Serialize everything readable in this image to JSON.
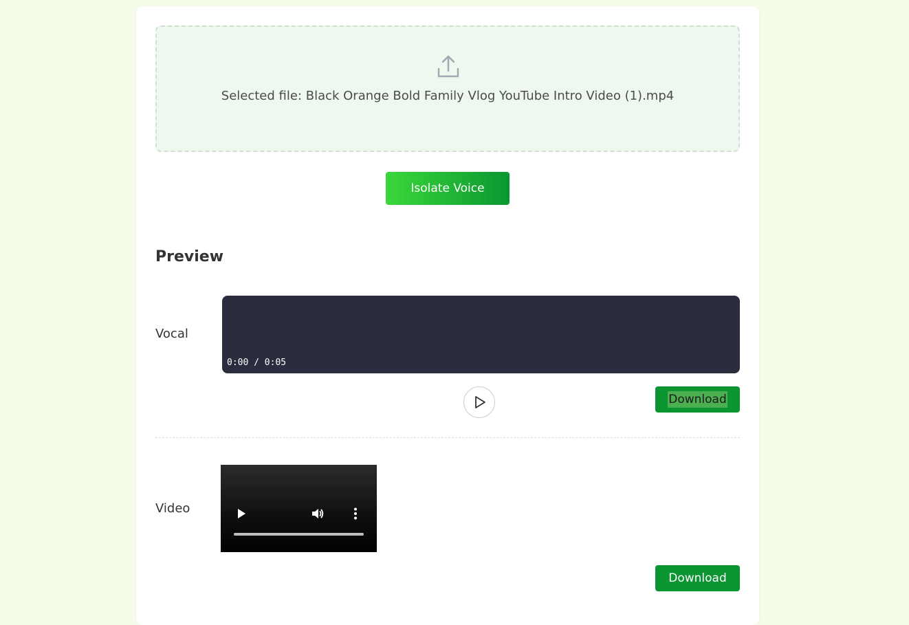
{
  "upload": {
    "icon": "upload-icon",
    "selected_file_text": "Selected file: Black Orange Bold Family Vlog YouTube Intro Video (1).mp4"
  },
  "actions": {
    "isolate_label": "Isolate Voice"
  },
  "preview": {
    "title": "Preview",
    "vocal": {
      "label": "Vocal",
      "time": "0:00 / 0:05",
      "play_icon": "play-icon",
      "download_label": "Download"
    },
    "video": {
      "label": "Video",
      "controls": [
        "play-icon",
        "volume-icon",
        "more-vert-icon"
      ],
      "progress": 0,
      "download_label": "Download"
    }
  },
  "colors": {
    "page_background": "#f5fcea",
    "accent_green": "#0a9432",
    "dropzone_background": "#eef8ee",
    "audio_player_background": "#2c2c3f"
  }
}
